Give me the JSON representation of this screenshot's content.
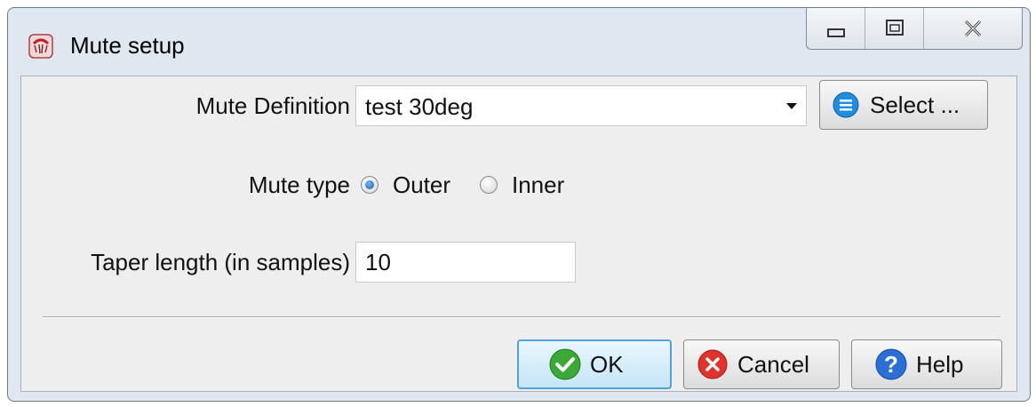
{
  "window": {
    "title": "Mute setup"
  },
  "form": {
    "mute_definition_label": "Mute Definition",
    "mute_definition_value": "test 30deg",
    "select_button_label": "Select ...",
    "mute_type_label": "Mute type",
    "mute_type_options": [
      "Outer",
      "Inner"
    ],
    "mute_type_selected": "Outer",
    "taper_length_label": "Taper length (in samples)",
    "taper_length_value": "10"
  },
  "buttons": {
    "ok_label": "OK",
    "cancel_label": "Cancel",
    "help_label": "Help"
  },
  "icons": {
    "app": "app-mute-icon",
    "minimize": "minimize-icon",
    "maximize": "maximize-icon",
    "close": "close-icon",
    "select": "list-icon",
    "ok": "check-icon",
    "cancel": "x-circle-icon",
    "help": "question-icon"
  },
  "colors": {
    "window_bg": "#dfe7f1",
    "client_bg": "#eeeeee",
    "default_button_border": "#4fa3d8",
    "ok_icon": "#3aa935",
    "cancel_icon": "#e0332c",
    "help_icon": "#2b6fd6",
    "select_icon": "#1f8ee0"
  }
}
